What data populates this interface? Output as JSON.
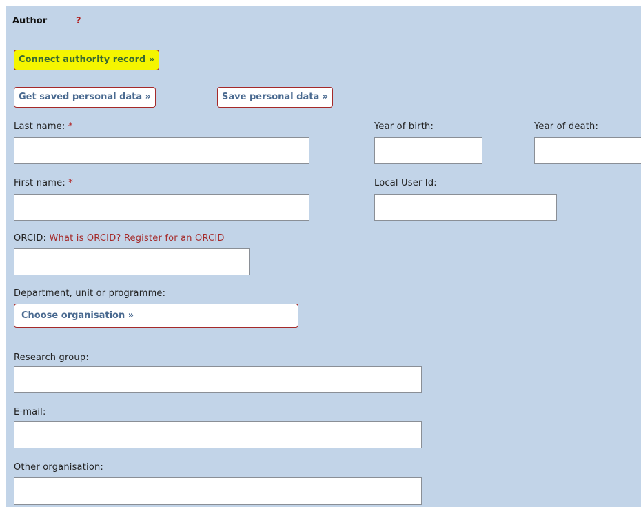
{
  "section": {
    "title": "Author",
    "help": "?"
  },
  "buttons": {
    "connect_authority": "Connect authority record »",
    "get_saved": "Get saved personal data »",
    "save_personal": "Save personal data »",
    "choose_org": "Choose organisation »"
  },
  "fields": {
    "last_name": {
      "label": "Last name:",
      "required": "*",
      "value": ""
    },
    "year_of_birth": {
      "label": "Year of birth:",
      "value": ""
    },
    "year_of_death": {
      "label": "Year of death:",
      "value": ""
    },
    "first_name": {
      "label": "First name:",
      "required": "*",
      "value": ""
    },
    "local_user_id": {
      "label": "Local User Id:",
      "value": ""
    },
    "orcid": {
      "label": "ORCID:",
      "value": "",
      "link_what": "What is ORCID?",
      "link_register": "Register for an ORCID"
    },
    "department": {
      "label": "Department, unit or programme:"
    },
    "research_group": {
      "label": "Research group:",
      "value": ""
    },
    "email": {
      "label": "E-mail:",
      "value": ""
    },
    "other_org": {
      "label": "Other organisation:",
      "value": ""
    }
  },
  "colors": {
    "panel_bg": "#c2d4e8",
    "highlight": "#f5f500",
    "required": "#b02020",
    "link": "#a52a2a"
  }
}
